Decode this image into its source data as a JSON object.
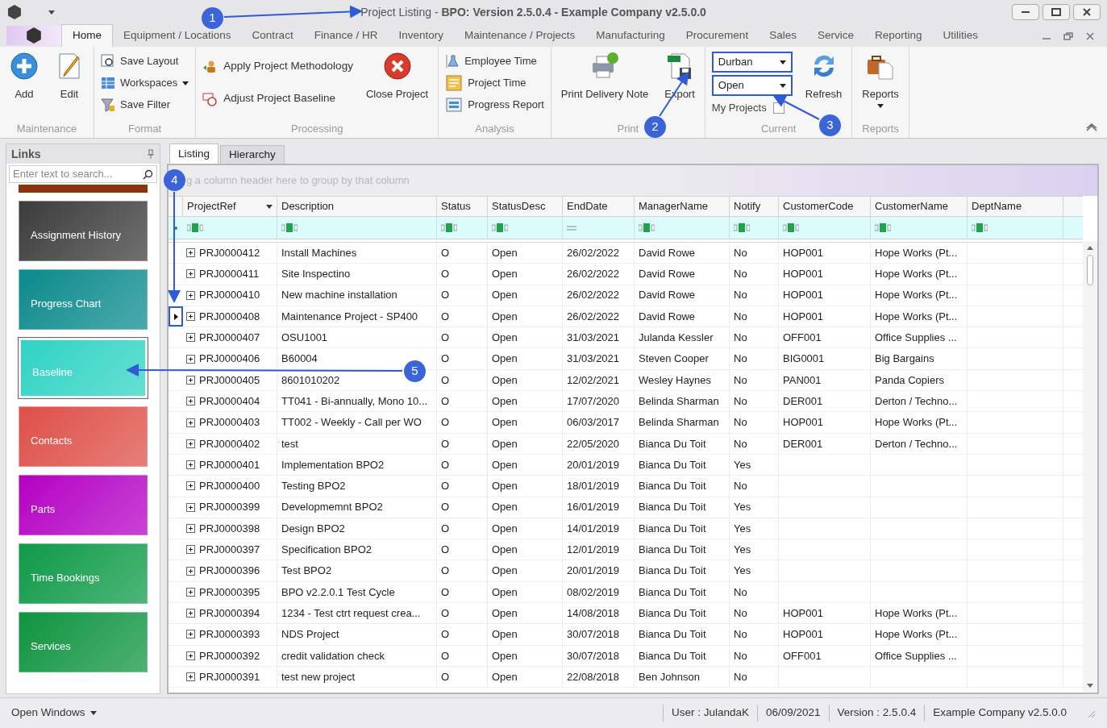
{
  "window": {
    "title": "Project Listing - **BPO: Version 2.5.0.4 - Example Company v2.5.0.0**"
  },
  "menu_tabs": [
    {
      "label": "Home",
      "selected": true
    },
    {
      "label": "Equipment / Locations",
      "selected": false
    },
    {
      "label": "Contract",
      "selected": false
    },
    {
      "label": "Finance / HR",
      "selected": false
    },
    {
      "label": "Inventory",
      "selected": false
    },
    {
      "label": "Maintenance / Projects",
      "selected": false
    },
    {
      "label": "Manufacturing",
      "selected": false
    },
    {
      "label": "Procurement",
      "selected": false
    },
    {
      "label": "Sales",
      "selected": false
    },
    {
      "label": "Service",
      "selected": false
    },
    {
      "label": "Reporting",
      "selected": false
    },
    {
      "label": "Utilities",
      "selected": false
    }
  ],
  "ribbon": [
    {
      "label": "Maintenance",
      "items": [
        {
          "kind": "large",
          "label": "Add"
        },
        {
          "kind": "large",
          "label": "Edit"
        }
      ]
    },
    {
      "label": "Format",
      "items": [
        {
          "kind": "small",
          "label": "Save Layout"
        },
        {
          "kind": "small",
          "label": "Workspaces",
          "dropdown": true
        },
        {
          "kind": "small",
          "label": "Save Filter"
        }
      ]
    },
    {
      "label": "Processing",
      "items": [
        {
          "kind": "medium",
          "label": "Apply Project Methodology"
        },
        {
          "kind": "medium",
          "label": "Adjust Project Baseline"
        },
        {
          "kind": "large",
          "label": "Close Project"
        }
      ]
    },
    {
      "label": "Analysis",
      "items": [
        {
          "kind": "small",
          "label": "Employee Time"
        },
        {
          "kind": "small",
          "label": "Project Time"
        },
        {
          "kind": "small",
          "label": "Progress Report"
        }
      ]
    },
    {
      "label": "Print",
      "items": [
        {
          "kind": "large",
          "label": "Print Delivery Note"
        },
        {
          "kind": "large",
          "label": "Export"
        }
      ]
    },
    {
      "label": "Current",
      "items": [
        {
          "kind": "combo",
          "value": "Durban",
          "highlighted": true
        },
        {
          "kind": "combo",
          "value": "Open",
          "highlighted": true
        },
        {
          "kind": "check",
          "label": "My Projects",
          "checked": false
        },
        {
          "kind": "large",
          "label": "Refresh"
        }
      ]
    },
    {
      "label": "Reports",
      "items": [
        {
          "kind": "large",
          "label": "Reports",
          "dropdown": true
        }
      ]
    }
  ],
  "links": {
    "title": "Links",
    "search": {
      "placeholder": "Enter text to search..."
    },
    "tiles": [
      {
        "color": "#8a3410"
      },
      {
        "label": "Assignment History",
        "color": "#3c3c3c",
        "selected": false
      },
      {
        "label": "Progress Chart",
        "color": "#0b8a8c",
        "selected": false
      },
      {
        "label": "Baseline",
        "color": "#2fd3c4",
        "selected": true
      },
      {
        "label": "Contacts",
        "color": "#de4f48",
        "selected": false
      },
      {
        "label": "Parts",
        "color": "#b400c4",
        "selected": false
      },
      {
        "label": "Time Bookings",
        "color": "#0e9a48",
        "selected": false
      },
      {
        "label": "Services",
        "color": "#0f9440",
        "selected": false
      }
    ]
  },
  "view_tabs": [
    {
      "label": "Listing",
      "selected": true
    },
    {
      "label": "Hierarchy",
      "selected": false
    }
  ],
  "group_panel": "g a column header here to group by that column",
  "table": {
    "columns": [
      {
        "label": "ProjectRef",
        "dropdown": true
      },
      {
        "label": "Description"
      },
      {
        "label": "Status"
      },
      {
        "label": "StatusDesc"
      },
      {
        "label": "EndDate",
        "kind": "date"
      },
      {
        "label": "ManagerName"
      },
      {
        "label": "Notify"
      },
      {
        "label": "CustomerCode"
      },
      {
        "label": "CustomerName"
      },
      {
        "label": "DeptName"
      }
    ],
    "rows": [
      {
        "focused": false,
        "cells": [
          "PRJ0000412",
          "Install Machines",
          "O",
          "Open",
          "26/02/2022",
          "David Rowe",
          "No",
          "HOP001",
          "Hope Works (Pt..."
        ]
      },
      {
        "focused": false,
        "cells": [
          "PRJ0000411",
          "Site Inspectino",
          "O",
          "Open",
          "26/02/2022",
          "David Rowe",
          "No",
          "HOP001",
          "Hope Works (Pt..."
        ]
      },
      {
        "focused": false,
        "cells": [
          "PRJ0000410",
          "New machine installation",
          "O",
          "Open",
          "26/02/2022",
          "David Rowe",
          "No",
          "HOP001",
          "Hope Works (Pt..."
        ]
      },
      {
        "focused": true,
        "cells": [
          "PRJ0000408",
          "Maintenance Project - SP400",
          "O",
          "Open",
          "26/02/2022",
          "David Rowe",
          "No",
          "HOP001",
          "Hope Works (Pt..."
        ]
      },
      {
        "focused": false,
        "cells": [
          "PRJ0000407",
          "OSU1001",
          "O",
          "Open",
          "31/03/2021",
          "Julanda Kessler",
          "No",
          "OFF001",
          "Office Supplies ..."
        ]
      },
      {
        "focused": false,
        "cells": [
          "PRJ0000406",
          "B60004",
          "O",
          "Open",
          "31/03/2021",
          "Steven Cooper",
          "No",
          "BIG0001",
          "Big Bargains"
        ]
      },
      {
        "focused": false,
        "cells": [
          "PRJ0000405",
          "8601010202",
          "O",
          "Open",
          "12/02/2021",
          "Wesley Haynes",
          "No",
          "PAN001",
          "Panda Copiers"
        ]
      },
      {
        "focused": false,
        "cells": [
          "PRJ0000404",
          "TT041 - Bi-annually, Mono 10...",
          "O",
          "Open",
          "17/07/2020",
          "Belinda Sharman",
          "No",
          "DER001",
          "Derton / Techno..."
        ]
      },
      {
        "focused": false,
        "cells": [
          "PRJ0000403",
          "TT002 - Weekly - Call per WO",
          "O",
          "Open",
          "06/03/2017",
          "Belinda Sharman",
          "No",
          "HOP001",
          "Hope Works (Pt..."
        ]
      },
      {
        "focused": false,
        "cells": [
          "PRJ0000402",
          "test",
          "O",
          "Open",
          "22/05/2020",
          "Bianca Du Toit",
          "No",
          "DER001",
          "Derton / Techno..."
        ]
      },
      {
        "focused": false,
        "cells": [
          "PRJ0000401",
          "Implementation BPO2",
          "O",
          "Open",
          "20/01/2019",
          "Bianca Du Toit",
          "Yes"
        ]
      },
      {
        "focused": false,
        "cells": [
          "PRJ0000400",
          "Testing BPO2",
          "O",
          "Open",
          "18/01/2019",
          "Bianca Du Toit",
          "No"
        ]
      },
      {
        "focused": false,
        "cells": [
          "PRJ0000399",
          "Developmemnt BPO2",
          "O",
          "Open",
          "16/01/2019",
          "Bianca Du Toit",
          "Yes"
        ]
      },
      {
        "focused": false,
        "cells": [
          "PRJ0000398",
          "Design BPO2",
          "O",
          "Open",
          "14/01/2019",
          "Bianca Du Toit",
          "Yes"
        ]
      },
      {
        "focused": false,
        "cells": [
          "PRJ0000397",
          "Specification BPO2",
          "O",
          "Open",
          "12/01/2019",
          "Bianca Du Toit",
          "Yes"
        ]
      },
      {
        "focused": false,
        "cells": [
          "PRJ0000396",
          "Test BPO2",
          "O",
          "Open",
          "20/01/2019",
          "Bianca Du Toit",
          "Yes"
        ]
      },
      {
        "focused": false,
        "cells": [
          "PRJ0000395",
          "BPO v2.2.0.1 Test Cycle",
          "O",
          "Open",
          "08/02/2019",
          "Bianca Du Toit",
          "No"
        ]
      },
      {
        "focused": false,
        "cells": [
          "PRJ0000394",
          "1234 - Test ctrt request crea...",
          "O",
          "Open",
          "14/08/2018",
          "Bianca Du Toit",
          "No",
          "HOP001",
          "Hope Works (Pt..."
        ]
      },
      {
        "focused": false,
        "cells": [
          "PRJ0000393",
          "NDS Project",
          "O",
          "Open",
          "30/07/2018",
          "Bianca Du Toit",
          "No",
          "HOP001",
          "Hope Works (Pt..."
        ]
      },
      {
        "focused": false,
        "cells": [
          "PRJ0000392",
          "credit validation check",
          "O",
          "Open",
          "30/07/2018",
          "Bianca Du Toit",
          "No",
          "OFF001",
          "Office Supplies ..."
        ]
      },
      {
        "focused": false,
        "cells": [
          "PRJ0000391",
          "test new project",
          "O",
          "Open",
          "22/08/2018",
          "Ben Johnson",
          "No"
        ]
      }
    ]
  },
  "status_bar": {
    "open_windows": "Open Windows",
    "items": [
      "User : JulandaK",
      "06/09/2021",
      "Version : 2.5.0.4",
      "Example Company v2.5.0.0"
    ]
  },
  "callouts": [
    "1",
    "2",
    "3",
    "4",
    "5"
  ]
}
